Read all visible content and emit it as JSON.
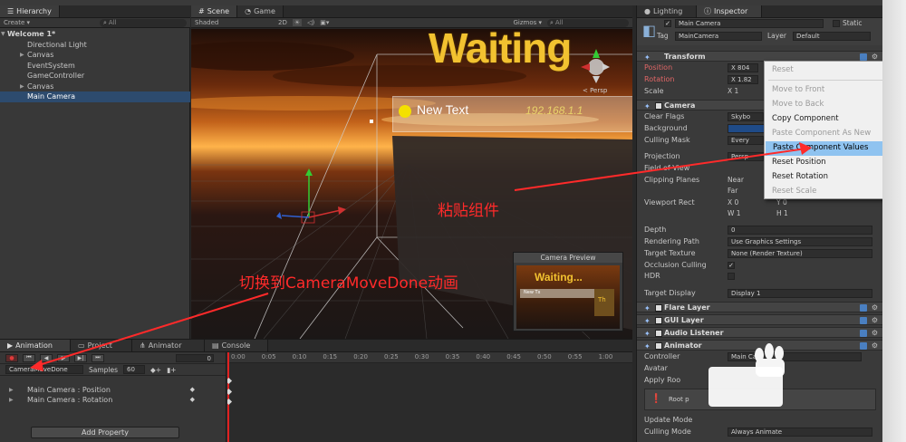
{
  "hierarchy": {
    "tab_label": "Hierarchy",
    "create_label": "Create",
    "search_placeholder": "All",
    "items": [
      {
        "label": "Welcome 1*",
        "level": 0,
        "expanded": true
      },
      {
        "label": "Directional Light",
        "level": 1
      },
      {
        "label": "Canvas",
        "level": 1,
        "collapsed": true
      },
      {
        "label": "EventSystem",
        "level": 1
      },
      {
        "label": "GameController",
        "level": 1
      },
      {
        "label": "Canvas",
        "level": 1,
        "collapsed": true
      },
      {
        "label": "Main Camera",
        "level": 1,
        "selected": true
      }
    ]
  },
  "scene": {
    "tabs": [
      "Scene",
      "Game"
    ],
    "shading_mode": "Shaded",
    "mode_2d": "2D",
    "gizmos_label": "Gizmos",
    "search_placeholder": "All",
    "waiting_text": "Waiting",
    "ui_new_text": "New Text",
    "ui_ip_text": "192.168.1.1",
    "persp_label": "< Persp",
    "annotation_paste": "粘贴组件",
    "annotation_switch": "切换到CameraMoveDone动画",
    "camera_preview": {
      "title": "Camera Preview",
      "waiting_text": "Waiting...",
      "bar_label": "New Tx",
      "side_label": "Th"
    }
  },
  "animation": {
    "tabs": [
      "Animation",
      "Project",
      "Animator",
      "Console"
    ],
    "current_frame": "0",
    "clip_name": "CameraMoveDone",
    "samples_label": "Samples",
    "samples_value": "60",
    "properties": [
      "Main Camera : Position",
      "Main Camera : Rotation"
    ],
    "add_property_label": "Add Property",
    "ruler_ticks": [
      "0:00",
      "0:05",
      "0:10",
      "0:15",
      "0:20",
      "0:25",
      "0:30",
      "0:35",
      "0:40",
      "0:45",
      "0:50",
      "0:55",
      "1:00"
    ]
  },
  "inspector": {
    "tabs": [
      "Lighting",
      "Inspector"
    ],
    "object_name": "Main Camera",
    "static_label": "Static",
    "tag_label": "Tag",
    "tag_value": "MainCamera",
    "layer_label": "Layer",
    "layer_value": "Default",
    "transform": {
      "header": "Transform",
      "position_label": "Position",
      "position_x": "X 804",
      "rotation_label": "Rotation",
      "rotation_x": "X 1.82",
      "scale_label": "Scale",
      "scale_x": "X 1"
    },
    "camera": {
      "header": "Camera",
      "clear_flags_label": "Clear Flags",
      "clear_flags_value": "Skybo",
      "background_label": "Background",
      "culling_mask_label": "Culling Mask",
      "culling_mask_value": "Every",
      "projection_label": "Projection",
      "projection_value": "Persp",
      "field_of_view_label": "Field of View",
      "clipping_planes_label": "Clipping Planes",
      "near_label": "Near",
      "far_label": "Far",
      "viewport_rect_label": "Viewport Rect",
      "viewport_x": "X 0",
      "viewport_y": "Y 0",
      "viewport_w": "W 1",
      "viewport_h": "H 1",
      "depth_label": "Depth",
      "depth_value": "0",
      "rendering_path_label": "Rendering Path",
      "rendering_path_value": "Use Graphics Settings",
      "target_texture_label": "Target Texture",
      "target_texture_value": "None (Render Texture)",
      "occlusion_culling_label": "Occlusion Culling",
      "hdr_label": "HDR",
      "target_display_label": "Target Display",
      "target_display_value": "Display 1"
    },
    "flare_layer_header": "Flare Layer",
    "gui_layer_header": "GUI Layer",
    "audio_listener_header": "Audio Listener",
    "animator": {
      "header": "Animator",
      "controller_label": "Controller",
      "controller_value": "Main Ca",
      "avatar_label": "Avatar",
      "apply_root_label": "Apply Roo",
      "info_text": "Root p",
      "update_mode_label": "Update Mode",
      "culling_mode_label": "Culling Mode",
      "culling_mode_value": "Always Animate"
    }
  },
  "context_menu": {
    "items": [
      {
        "label": "Reset",
        "enabled": false
      },
      {
        "label": "Move to Front",
        "enabled": false
      },
      {
        "label": "Move to Back",
        "enabled": false
      },
      {
        "label": "Copy Component",
        "enabled": true
      },
      {
        "label": "Paste Component As New",
        "enabled": false
      },
      {
        "label": "Paste Component Values",
        "enabled": true,
        "highlighted": true
      },
      {
        "label": "Reset Position",
        "enabled": true
      },
      {
        "label": "Reset Rotation",
        "enabled": true
      },
      {
        "label": "Reset Scale",
        "enabled": false
      }
    ]
  },
  "colors": {
    "annotation_red": "#ff2a2a",
    "selection_blue": "#2d4b6e",
    "menu_highlight": "#8fc3f0",
    "text_yellow": "#f2c230"
  }
}
